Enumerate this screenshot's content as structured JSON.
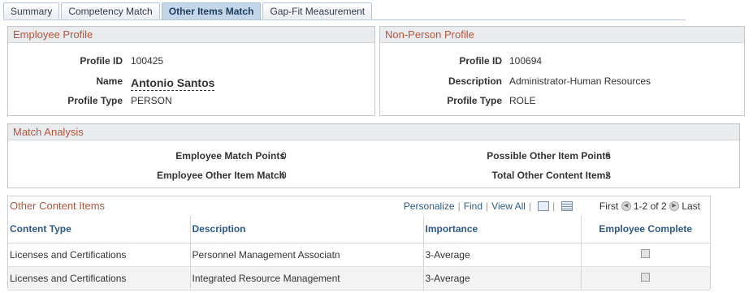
{
  "tabs": [
    {
      "label": "Summary"
    },
    {
      "label": "Competency Match"
    },
    {
      "label": "Other Items Match"
    },
    {
      "label": "Gap-Fit Measurement"
    }
  ],
  "employee_profile": {
    "title": "Employee Profile",
    "profile_id_label": "Profile ID",
    "profile_id": "100425",
    "name_label": "Name",
    "name": "Antonio Santos",
    "profile_type_label": "Profile Type",
    "profile_type": "PERSON"
  },
  "non_person_profile": {
    "title": "Non-Person Profile",
    "profile_id_label": "Profile ID",
    "profile_id": "100694",
    "description_label": "Description",
    "description": "Administrator-Human Resources",
    "profile_type_label": "Profile Type",
    "profile_type": "ROLE"
  },
  "match_analysis": {
    "title": "Match Analysis",
    "emp_match_points_label": "Employee Match Points",
    "emp_match_points": "0",
    "emp_other_item_match_label": "Employee Other Item Match",
    "emp_other_item_match": "0",
    "possible_points_label": "Possible Other Item Points",
    "possible_points": "6",
    "total_items_label": "Total Other Content Items",
    "total_items": "2"
  },
  "other_content": {
    "title": "Other Content Items",
    "personalize": "Personalize",
    "find": "Find",
    "view_all": "View All",
    "first": "First",
    "range": "1-2 of 2",
    "last": "Last",
    "columns": [
      "Content Type",
      "Description",
      "Importance",
      "Employee Complete"
    ],
    "rows": [
      {
        "content_type": "Licenses and Certifications",
        "description": "Personnel Management Associatn",
        "importance": "3-Average"
      },
      {
        "content_type": "Licenses and Certifications",
        "description": "Integrated Resource Management",
        "importance": "3-Average"
      }
    ]
  }
}
